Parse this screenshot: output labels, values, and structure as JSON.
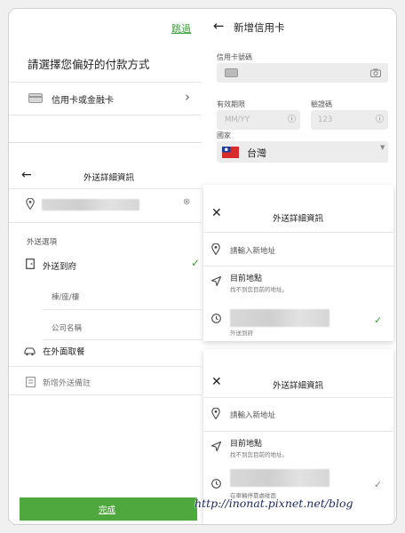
{
  "payment": {
    "skip": "跳過",
    "title": "請選擇您偏好的付款方式",
    "option_label": "信用卡或金融卡"
  },
  "add_card": {
    "title": "新增信用卡",
    "card_number_label": "信用卡號碼",
    "expiry_label": "有效期限",
    "expiry_placeholder": "MM/YY",
    "cvv_label": "驗證碼",
    "cvv_placeholder": "123",
    "country_label": "國家",
    "country_value": "台灣"
  },
  "delivery_left": {
    "title": "外送詳細資訊",
    "section_label": "外送選項",
    "option_door": "外送到府",
    "building_placeholder": "棟/座/樓",
    "company_placeholder": "公司名稱",
    "option_pickup": "在外面取餐",
    "note_placeholder": "新增外送備註",
    "done": "完成"
  },
  "delivery_right_1": {
    "title": "外送詳細資訊",
    "new_address": "請輸入新地址",
    "current_title": "目前地點",
    "current_sub": "找不到您目前的地址。",
    "saved_sub": "外送到府"
  },
  "delivery_right_2": {
    "title": "外送詳細資訊",
    "new_address": "請輸入新地址",
    "current_title": "目前地點",
    "current_sub": "找不到您目前的地址。",
    "saved_sub": "在車輛停靠處碰面"
  },
  "watermark": "http://inonat.pixnet.net/blog",
  "colors": {
    "accent_green": "#3aa33a",
    "done_button": "#4fa83d"
  }
}
